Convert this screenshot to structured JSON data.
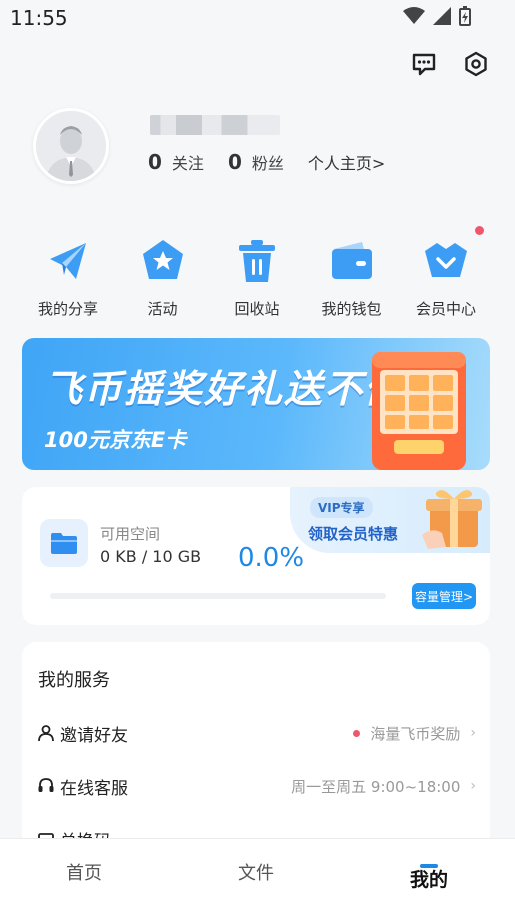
{
  "status_bar": {
    "time": "11:55"
  },
  "profile": {
    "following_count": "0",
    "following_label": "关注",
    "fans_count": "0",
    "fans_label": "粉丝",
    "homepage_link": "个人主页>"
  },
  "quick_actions": [
    {
      "label": "我的分享",
      "icon": "paper-plane-icon"
    },
    {
      "label": "活动",
      "icon": "star-badge-icon"
    },
    {
      "label": "回收站",
      "icon": "trash-icon"
    },
    {
      "label": "我的钱包",
      "icon": "wallet-icon"
    },
    {
      "label": "会员中心",
      "icon": "crown-icon"
    }
  ],
  "banner": {
    "title": "飞币摇奖好礼送不停",
    "subtitle": "100元京东E卡"
  },
  "storage": {
    "label": "可用空间",
    "size": "0 KB / 10 GB",
    "percent": "0.0%",
    "usage_fraction": 0.0,
    "vip_tag": "VIP专享",
    "vip_text": "领取会员特惠",
    "manage_button": "容量管理>"
  },
  "services": {
    "title": "我的服务",
    "items": [
      {
        "name": "邀请好友",
        "extra": "海量飞币奖励",
        "icon": "person-icon"
      },
      {
        "name": "在线客服",
        "extra": "周一至周五 9:00~18:00",
        "icon": "headset-icon"
      },
      {
        "name": "兑换码",
        "extra": "",
        "icon": "ticket-icon"
      }
    ]
  },
  "tabs": [
    {
      "label": "首页"
    },
    {
      "label": "文件"
    },
    {
      "label": "我的"
    }
  ],
  "colors": {
    "accent": "#1e88e5",
    "banner": "#4aaef8",
    "dot": "#f0566b"
  }
}
